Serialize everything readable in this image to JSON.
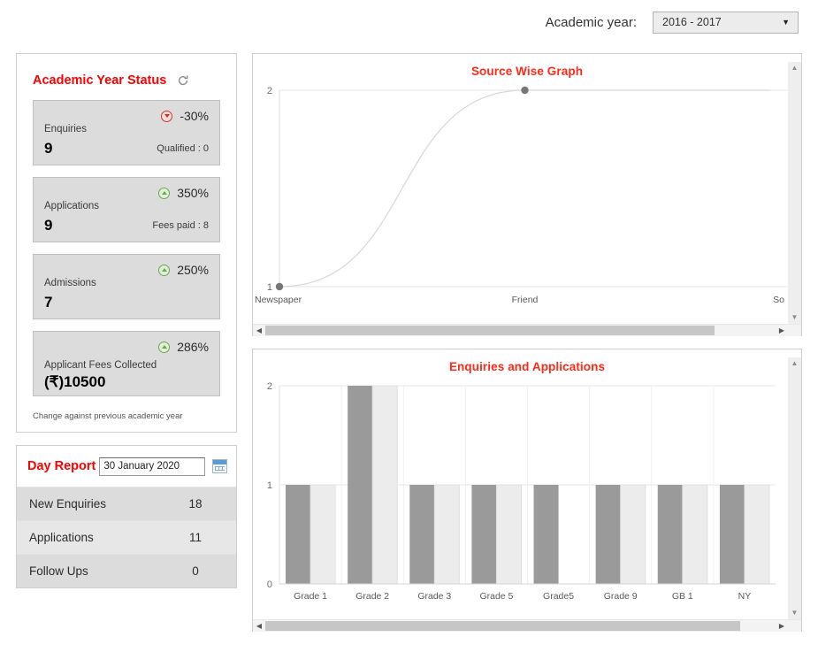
{
  "header": {
    "academic_year_label": "Academic year:",
    "academic_year_value": "2016 - 2017",
    "caret_icon": "chevron-down-icon"
  },
  "status_panel": {
    "title": "Academic Year Status",
    "refresh_icon": "refresh-icon",
    "footnote": "Change against previous academic year",
    "cards": [
      {
        "name": "Enquiries",
        "value": "9",
        "percent": "-30%",
        "direction": "down",
        "direction_icon": "arrow-down-circle-icon",
        "sub": "Qualified : 0"
      },
      {
        "name": "Applications",
        "value": "9",
        "percent": "350%",
        "direction": "up",
        "direction_icon": "arrow-up-circle-icon",
        "sub": "Fees paid : 8"
      },
      {
        "name": "Admissions",
        "value": "7",
        "percent": "250%",
        "direction": "up",
        "direction_icon": "arrow-up-circle-icon",
        "sub": ""
      },
      {
        "name": "Applicant Fees Collected",
        "value": "(₹)10500",
        "percent": "286%",
        "direction": "up",
        "direction_icon": "arrow-up-circle-icon",
        "sub": ""
      }
    ]
  },
  "day_report": {
    "title": "Day Report",
    "date_value": "30 January 2020",
    "calendar_icon": "calendar-icon",
    "rows": [
      {
        "label": "New Enquiries",
        "value": "18"
      },
      {
        "label": "Applications",
        "value": "11"
      },
      {
        "label": "Follow Ups",
        "value": "0"
      }
    ]
  },
  "colors": {
    "title_red": "#ff2a17",
    "heading_red": "#ff0000",
    "series_dark": "#9a9a9a",
    "series_light": "#ececec",
    "card_bg": "#dcdcdc"
  },
  "chart_data": [
    {
      "id": "source-wise-graph",
      "type": "line",
      "title": "Source Wise Graph",
      "xlabel": "",
      "ylabel": "",
      "categories": [
        "Newspaper",
        "Friend",
        "So"
      ],
      "tick_labels_x": [
        "Newspaper",
        "Friend",
        "So"
      ],
      "tick_labels_y": [
        "1",
        "2"
      ],
      "values": [
        1,
        2,
        2
      ],
      "ylim": [
        1,
        2
      ],
      "grid": true,
      "legend": "none",
      "markers": true,
      "smoothing": "spline",
      "line_color": "#d8d8d8",
      "marker_color": "#777777",
      "scroll": {
        "horizontal": true,
        "vertical": true
      }
    },
    {
      "id": "enquiries-and-applications",
      "type": "bar",
      "title": "Enquiries and Applications",
      "xlabel": "",
      "ylabel": "",
      "categories": [
        "Grade 1",
        "Grade 2",
        "Grade 3",
        "Grade 5",
        "Grade5",
        "Grade 9",
        "GB 1",
        "NY"
      ],
      "tick_labels_y": [
        "0",
        "1",
        "2"
      ],
      "series": [
        {
          "name": "Enquiries",
          "color": "#9a9a9a",
          "values": [
            1,
            2,
            1,
            1,
            1,
            1,
            1,
            1
          ]
        },
        {
          "name": "Applications",
          "color": "#ececec",
          "values": [
            1,
            2,
            1,
            1,
            0,
            1,
            1,
            1
          ]
        }
      ],
      "ylim": [
        0,
        2
      ],
      "grid": true,
      "legend": "none",
      "scroll": {
        "horizontal": true,
        "vertical": true
      }
    }
  ]
}
